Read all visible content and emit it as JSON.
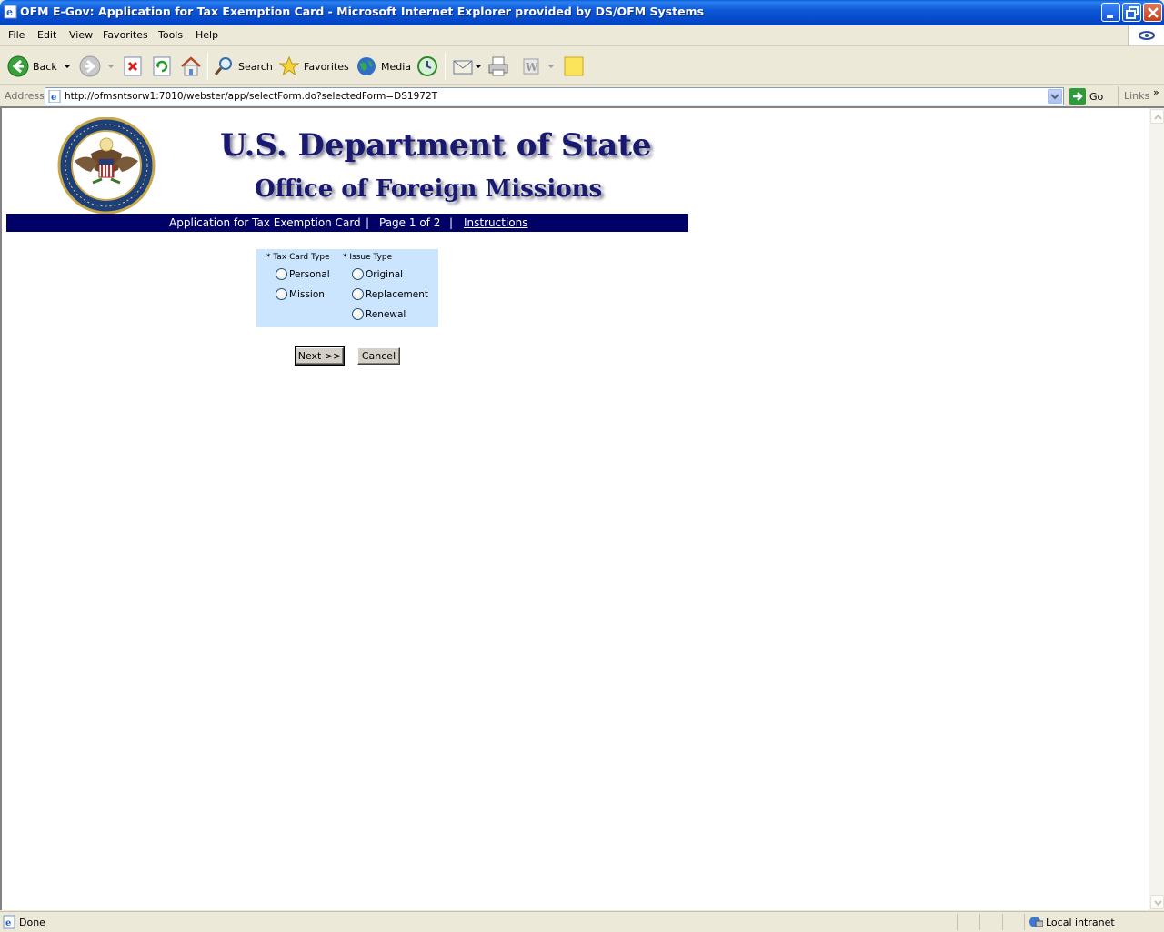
{
  "window": {
    "title": "OFM E-Gov: Application for Tax Exemption Card - Microsoft Internet Explorer provided by DS/OFM Systems"
  },
  "menu": [
    "File",
    "Edit",
    "View",
    "Favorites",
    "Tools",
    "Help"
  ],
  "toolbar": {
    "back": "Back",
    "search": "Search",
    "favorites": "Favorites",
    "media": "Media"
  },
  "address": {
    "label": "Address",
    "url": "http://ofmsntsorw1:7010/webster/app/selectForm.do?selectedForm=DS1972T",
    "go": "Go",
    "links": "Links"
  },
  "page": {
    "heading1": "U.S. Department of State",
    "heading2": "Office of Foreign Missions",
    "nav": {
      "app_title": "Application for Tax Exemption Card",
      "sep": "|",
      "page_info": "Page 1 of 2",
      "instructions": "Instructions"
    },
    "form": {
      "tax_card_type_label": "* Tax Card Type",
      "issue_type_label": "* Issue Type",
      "tax_card_options": [
        "Personal",
        "Mission"
      ],
      "issue_options": [
        "Original",
        "Replacement",
        "Renewal"
      ]
    },
    "buttons": {
      "next": "Next >>",
      "cancel": "Cancel"
    }
  },
  "status": {
    "text": "Done",
    "zone": "Local intranet"
  },
  "colors": {
    "header_text": "#191970",
    "nav_bar": "#000066",
    "form_box": "#cce5ff"
  }
}
